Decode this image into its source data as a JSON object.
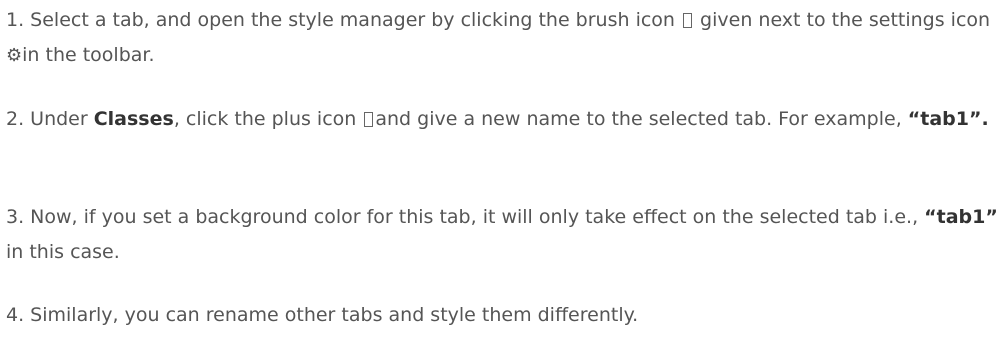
{
  "steps": [
    {
      "t1": "1. Select a tab, and open the style manager by clicking the brush icon ",
      "t2": " given next to the settings icon ",
      "t3": "in the toolbar.",
      "icon1": "brush-icon",
      "icon2": "settings-icon"
    },
    {
      "t1": "2. Under ",
      "b1": "Classes",
      "t2": ", click the plus icon ",
      "t3": "and give a new name to the selected tab. For example, ",
      "b2": "“tab1”.",
      "icon1": "plus-icon"
    },
    {
      "t1": "3. Now, if you set a background color for this tab, it will only take effect on the selected tab i.e., ",
      "b1": "“tab1”",
      "t2": " in this case."
    },
    {
      "t1": "4. Similarly, you can rename other tabs and style them differently."
    }
  ]
}
